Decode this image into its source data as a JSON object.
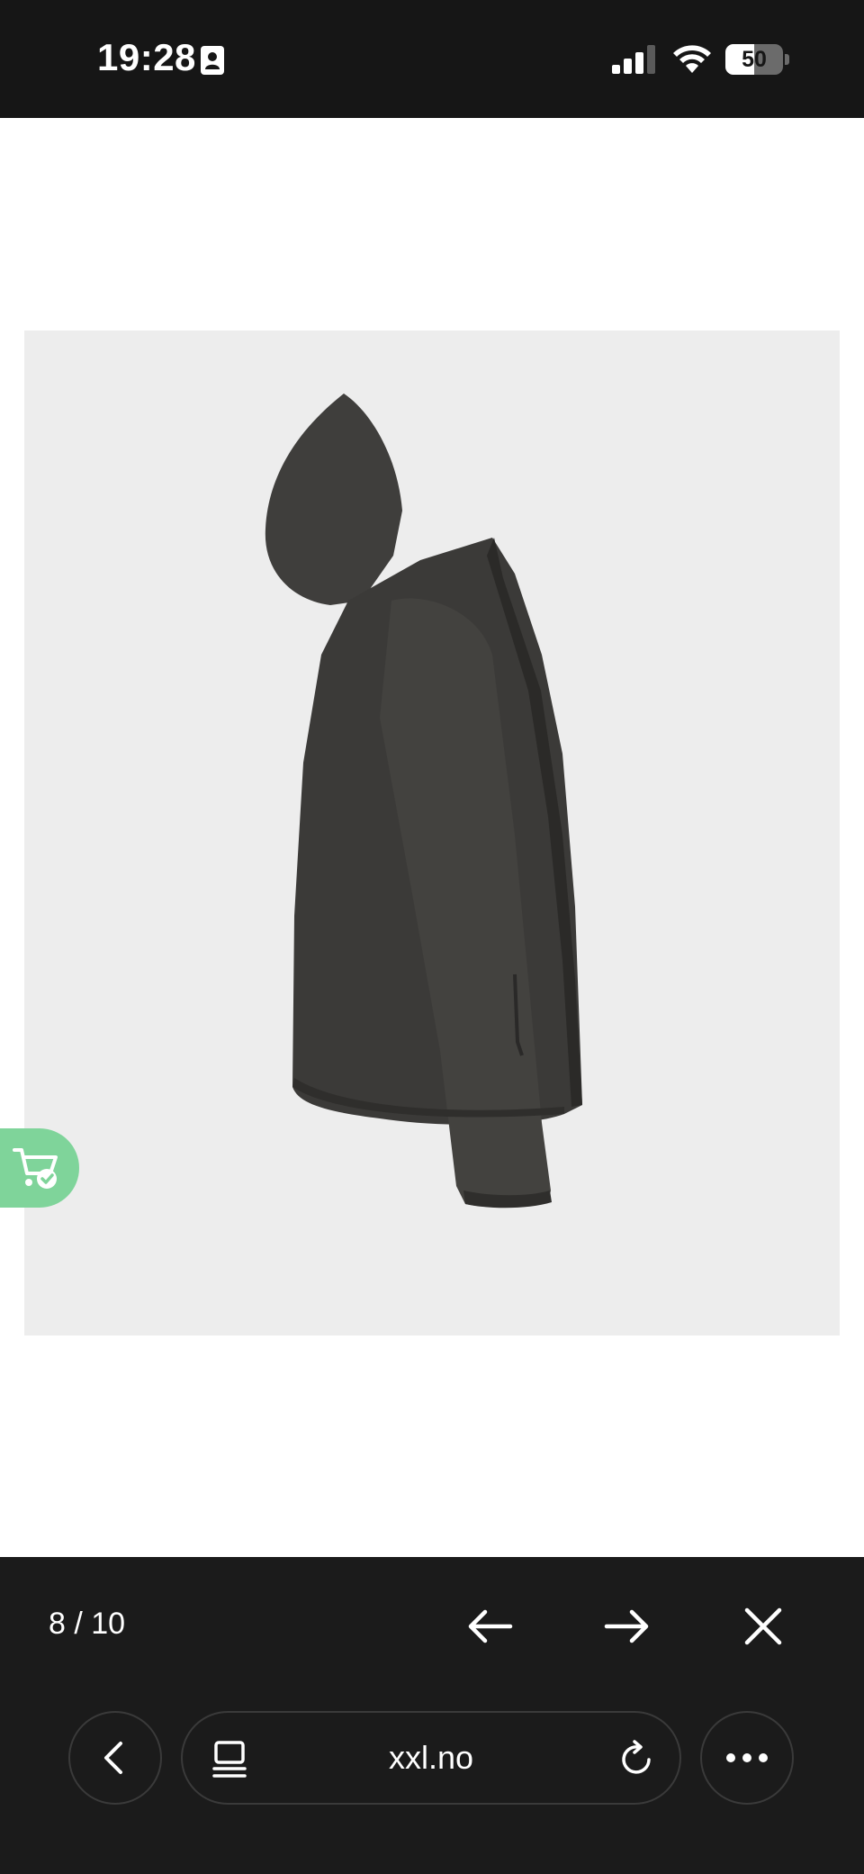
{
  "status_bar": {
    "time": "19:28",
    "battery_level": "50",
    "battery_fraction": 0.5,
    "icons": [
      "contact-card-icon",
      "signal-icon",
      "wifi-icon",
      "battery-icon"
    ]
  },
  "product": {
    "image_description_icon": "jacket-side-view",
    "image_background": "#ededed",
    "jacket_color": "#3d3c3a"
  },
  "floating_cart": {
    "icon": "cart-check-icon",
    "color": "#7fd49a"
  },
  "viewer": {
    "counter": "8 / 10",
    "prev_icon": "arrow-left-icon",
    "next_icon": "arrow-right-icon",
    "close_icon": "close-icon"
  },
  "browser": {
    "url": "xxl.no",
    "back_icon": "chevron-left-icon",
    "tabs_icon": "tabs-icon",
    "reload_icon": "reload-icon",
    "more_icon": "more-dots-icon"
  }
}
